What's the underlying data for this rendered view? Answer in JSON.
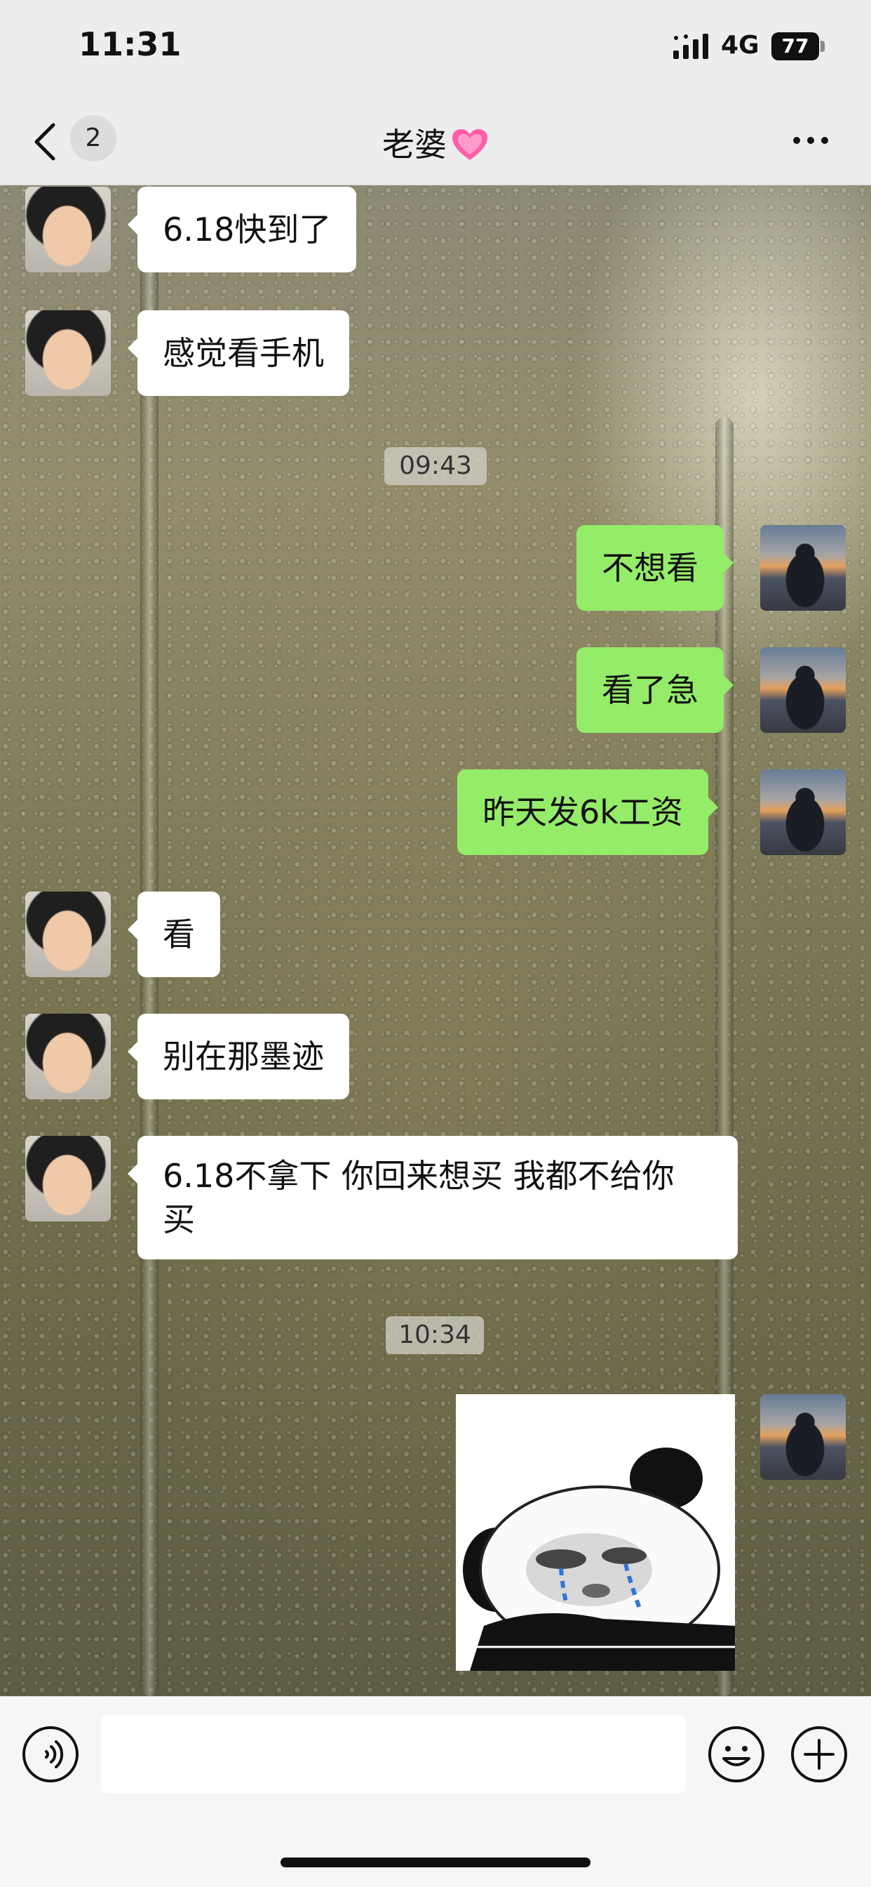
{
  "status_bar": {
    "time": "11:31",
    "network": "4G",
    "battery": "77"
  },
  "nav": {
    "unread_count": "2",
    "title": "老婆"
  },
  "messages": [
    {
      "from": "wife",
      "text": "6.18快到了"
    },
    {
      "from": "wife",
      "text": "感觉看手机"
    },
    {
      "type": "time",
      "text": "09:43"
    },
    {
      "from": "me",
      "text": "不想看"
    },
    {
      "from": "me",
      "text": "看了急"
    },
    {
      "from": "me",
      "text": "昨天发6k工资"
    },
    {
      "from": "wife",
      "text": "看"
    },
    {
      "from": "wife",
      "text": "别在那墨迹"
    },
    {
      "from": "wife",
      "text_line1": "6.18不拿下 你回来想买 我都不给你",
      "text_line2": "买"
    },
    {
      "type": "time",
      "text": "10:34"
    },
    {
      "from": "me",
      "type": "sticker",
      "sticker": "crying-panda"
    }
  ],
  "input": {
    "value": ""
  },
  "colors": {
    "outgoing_bubble": "#95ec69",
    "incoming_bubble": "#ffffff",
    "bar_background": "#ededed"
  }
}
